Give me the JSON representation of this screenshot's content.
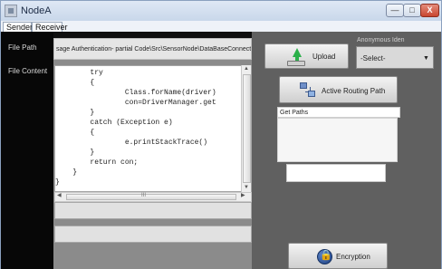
{
  "window": {
    "title": "NodeA",
    "controls": {
      "minimize": "—",
      "maximize": "□",
      "close": "X"
    }
  },
  "tabs": [
    {
      "label": "Sender"
    },
    {
      "label": "Receiver"
    }
  ],
  "sender": {
    "file_path_label": "File Path",
    "file_content_label": "File Content",
    "file_path_value": "sage Authentication- partial Code\\Src\\SensorNode\\DataBaseConnection.java",
    "code_lines": [
      "        try",
      "        {",
      "                Class.forName(driver)",
      "                con=DriverManager.get",
      "        }",
      "        catch (Exception e)",
      "        {",
      "                e.printStackTrace()",
      "        }",
      "        return con;",
      "    }",
      "}"
    ],
    "hscroll_thumb_text": "III",
    "upload_label": "Upload",
    "anonymous_label": "Anonymous Iden",
    "select_value": "-Select-",
    "routing_label": "Active Routing Path",
    "get_paths_label": "Get Paths",
    "encryption_label": "Encryption"
  }
}
